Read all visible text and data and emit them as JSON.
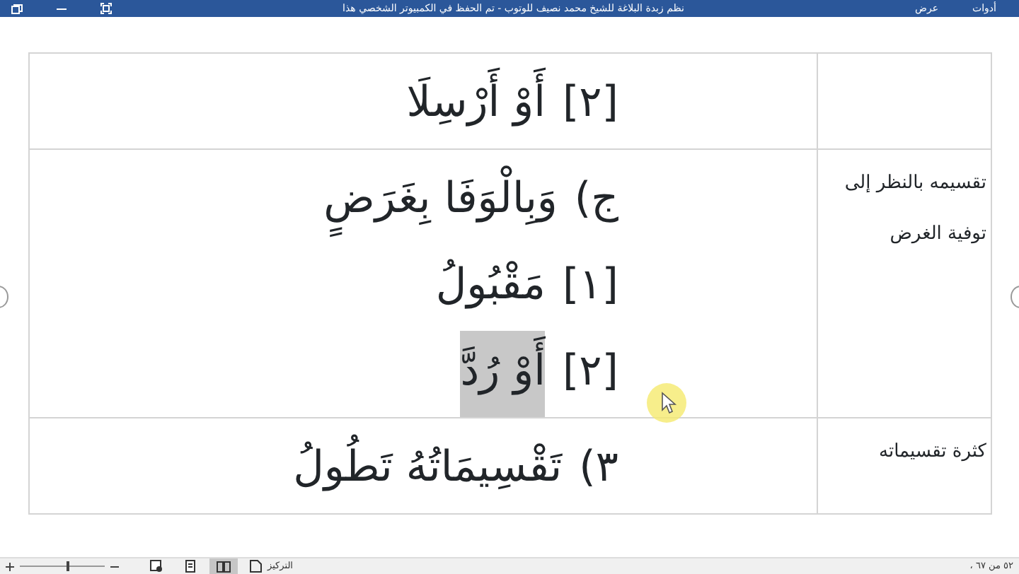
{
  "window": {
    "title": "نظم زبدة البلاغة للشيخ محمد نصيف للوتوب - تم الحفظ في الكمبيوتر الشخصي هذا"
  },
  "menu": [
    {
      "label": "أدوات"
    },
    {
      "label": "عرض"
    }
  ],
  "table": {
    "rows": [
      {
        "heading": "",
        "lines": [
          {
            "number": "[٢]",
            "text": "أَوْ أَرْسِلَا",
            "selected": false
          }
        ]
      },
      {
        "heading": "تقسيمه بالنظر إلى توفية الغرض",
        "lines": [
          {
            "number": "ج)",
            "text": "وَبِالْوَفَا بِغَرَضٍ",
            "selected": false
          },
          {
            "number": "[١]",
            "text": "مَقْبُولُ",
            "selected": false
          },
          {
            "number": "[٢]",
            "text": "أَوْ رُدَّ",
            "selected": true
          }
        ]
      },
      {
        "heading": "كثرة تقسيماته",
        "lines": [
          {
            "number": "٣)",
            "text": "تَقْسِيمَاتُهُ تَطُولُ",
            "selected": false
          }
        ]
      }
    ]
  },
  "status_bar": {
    "page": "، ٥٢ من ٦٧",
    "focus": "التركيز",
    "views": [
      {
        "kind": "read",
        "selected": true
      },
      {
        "kind": "print",
        "selected": false
      },
      {
        "kind": "web",
        "selected": false
      }
    ],
    "zoom": {
      "level": 0.55
    }
  }
}
